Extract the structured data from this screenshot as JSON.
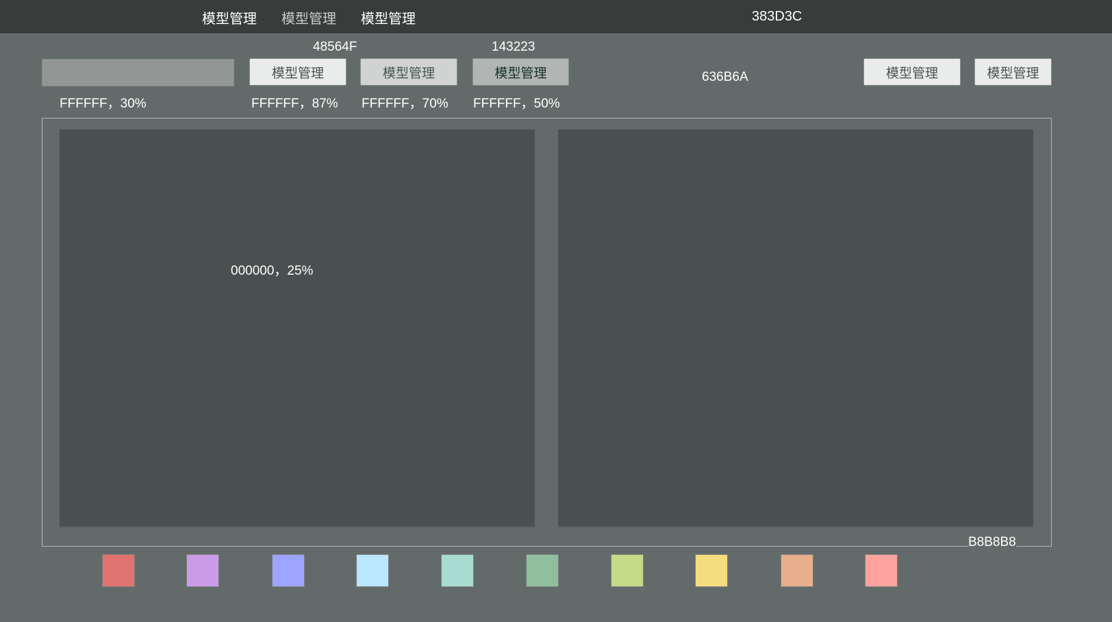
{
  "header": {
    "nav": [
      "模型管理",
      "模型管理",
      "模型管理"
    ],
    "color_label": "383D3C"
  },
  "toolbar": {
    "input_value": "",
    "input_caption": "FFFFFF，30%",
    "buttons": [
      {
        "label": "模型管理",
        "caption": "FFFFFF，87%"
      },
      {
        "label": "模型管理",
        "caption": "FFFFFF，70%"
      },
      {
        "label": "模型管理",
        "caption": "FFFFFF，50%"
      }
    ],
    "text_color_default": "48564F",
    "text_color_active": "143223",
    "bg_label": "636B6A",
    "right_buttons": [
      "模型管理",
      "模型管理"
    ]
  },
  "main": {
    "panel_label": "000000，25%",
    "border_label": "B8B8B8"
  },
  "palette": [
    "#E07370",
    "#CC9CE8",
    "#9DA5FF",
    "#BAE6FF",
    "#A8DCD1",
    "#8FBF9F",
    "#C3DA86",
    "#F5DC7E",
    "#E8AF8D",
    "#FFA39E"
  ]
}
